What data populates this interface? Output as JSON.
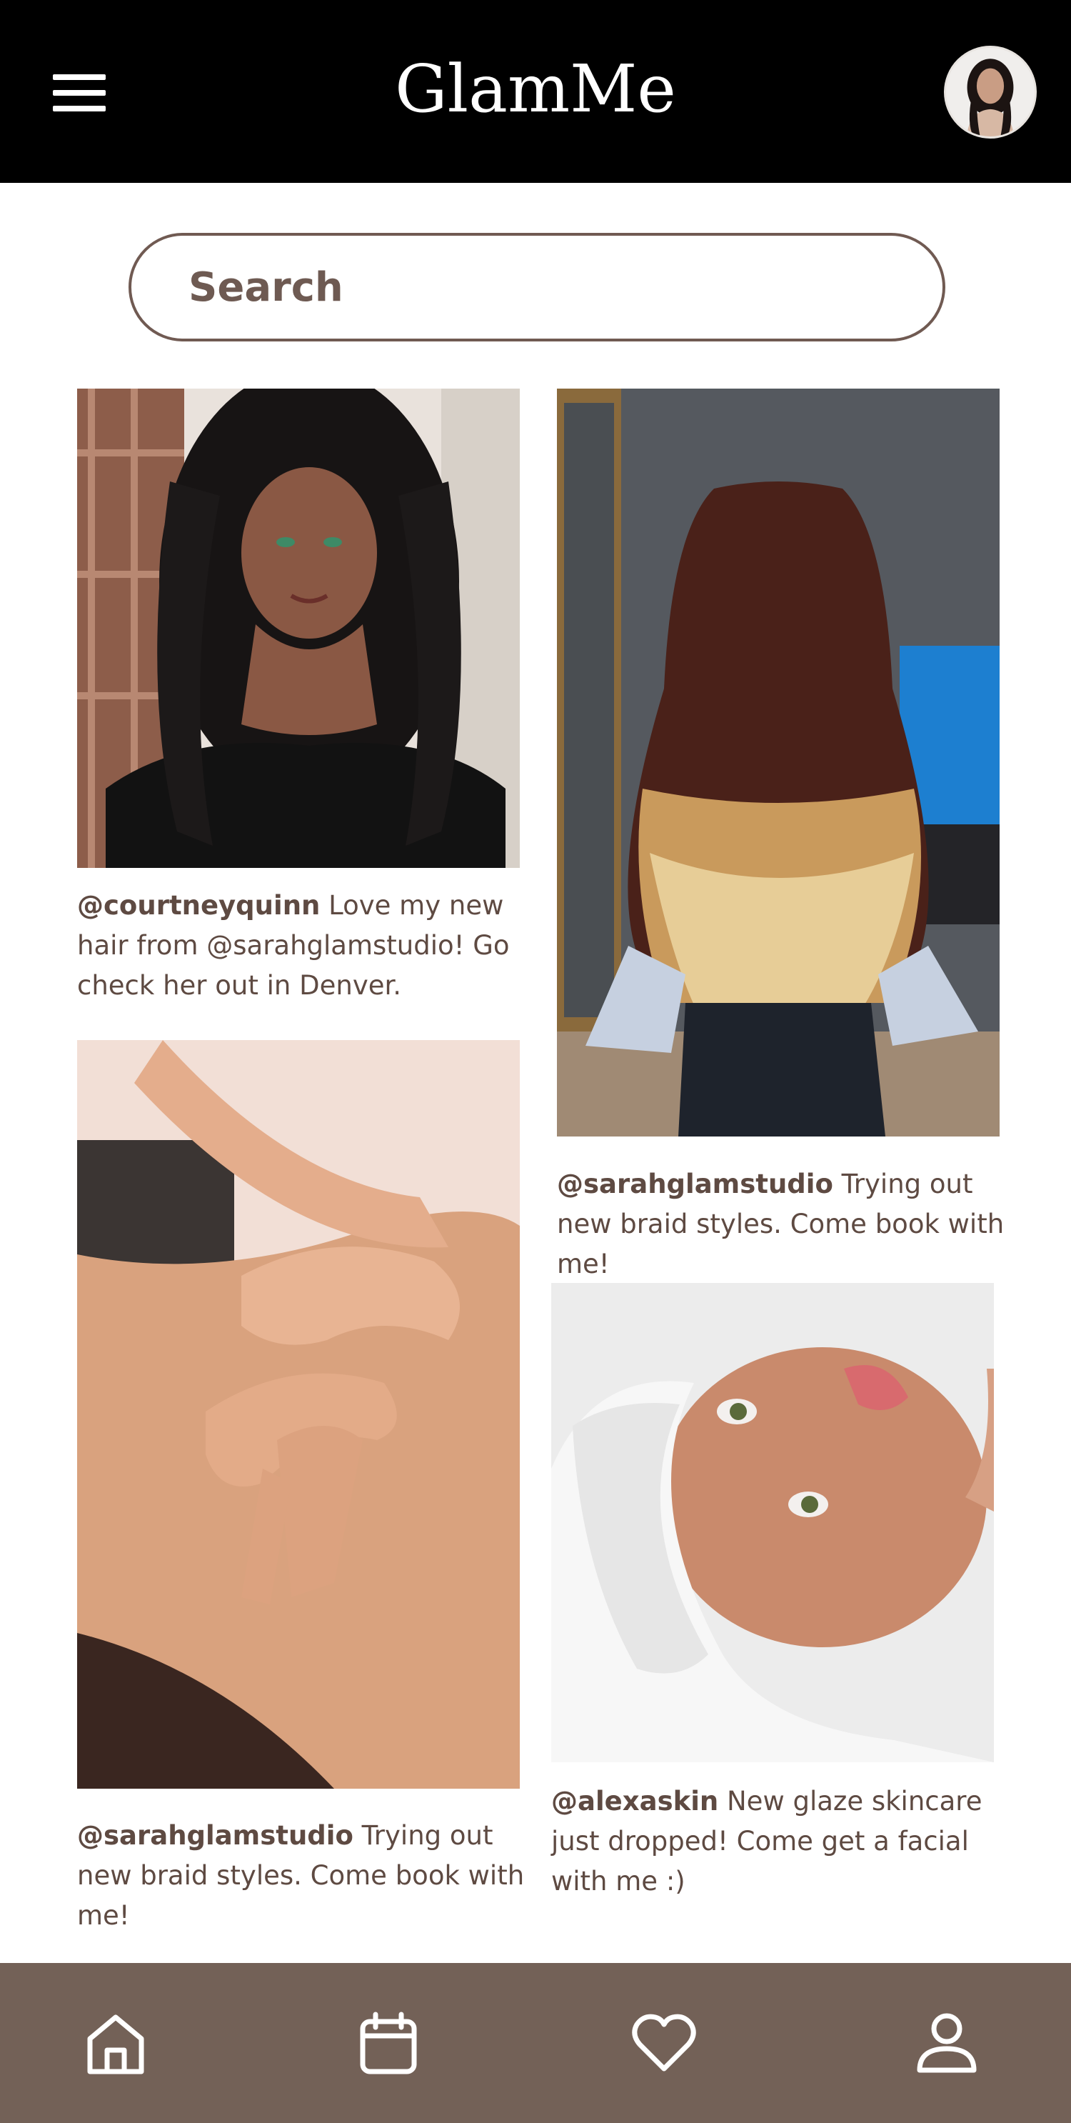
{
  "header": {
    "title": "GlamMe",
    "menu_icon": "hamburger-menu-icon",
    "avatar_alt": "profile-avatar"
  },
  "search": {
    "placeholder": "Search",
    "value": ""
  },
  "feed": [
    {
      "user": "@courtneyquinn",
      "text": "Love my new hair from @sarahglamstudio! Go check her out in Denver.",
      "image": "woman with long black twist braids"
    },
    {
      "user": "@sarahglamstudio",
      "text": "Trying out new braid styles. Come book with me!",
      "image": "ombre goddess braids from behind"
    },
    {
      "user": "@sarahglamstudio",
      "text": "Trying out new braid styles. Come book with me!",
      "image": "massage hands on back"
    },
    {
      "user": "@alexaskin",
      "text": "New glaze skincare just dropped! Come get a facial with me :)",
      "image": "woman receiving facial with headband"
    }
  ],
  "bottom_nav": {
    "items": [
      {
        "name": "home",
        "icon": "home-icon"
      },
      {
        "name": "calendar",
        "icon": "calendar-icon"
      },
      {
        "name": "favorites",
        "icon": "heart-icon"
      },
      {
        "name": "profile",
        "icon": "user-icon"
      }
    ]
  },
  "colors": {
    "header_bg": "#000000",
    "accent_brown": "#736157",
    "text_brown": "#5e4a42"
  }
}
